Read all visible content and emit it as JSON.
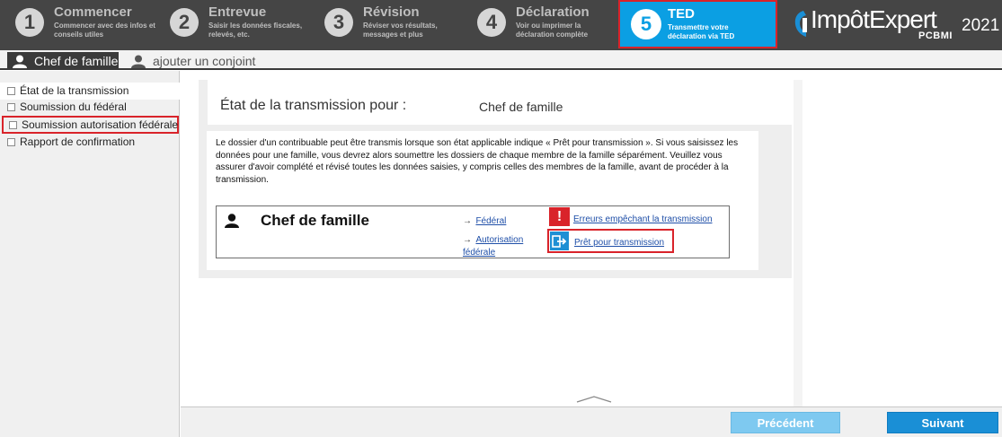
{
  "steps": [
    {
      "num": "1",
      "title": "Commencer",
      "desc": "Commencer avec des infos et conseils utiles"
    },
    {
      "num": "2",
      "title": "Entrevue",
      "desc": "Saisir les données fiscales, relevés, etc."
    },
    {
      "num": "3",
      "title": "Révision",
      "desc": "Réviser vos résultats, messages et plus"
    },
    {
      "num": "4",
      "title": "Déclaration",
      "desc": "Voir ou imprimer la déclaration complète"
    },
    {
      "num": "5",
      "title": "TED",
      "desc": "Transmettre votre déclaration via TED"
    }
  ],
  "logo": {
    "brand": "ImpôtExpert",
    "sub": "PCBMI",
    "year": "2021"
  },
  "tabs": {
    "active": "Chef de famille",
    "add": "ajouter un conjoint"
  },
  "sidebar": {
    "items": [
      {
        "label": "État de la transmission"
      },
      {
        "label": "Soumission du fédéral"
      },
      {
        "label": "Soumission autorisation fédérale"
      },
      {
        "label": "Rapport de confirmation"
      }
    ]
  },
  "main": {
    "heading": "État de la transmission pour :",
    "member": "Chef de famille",
    "info": "Le dossier d'un contribuable peut être transmis lorsque son état applicable indique « Prêt pour transmission ». Si vous saisissez les données pour une famille, vous devrez alors soumettre les dossiers de chaque membre de la famille séparément. Veuillez vous assurer d'avoir complété et révisé toutes les données saisies, y compris celles des membres de la famille, avant de procéder à la transmission.",
    "member_card": {
      "name": "Chef de famille",
      "arrow": "→",
      "link_federal": "Fédéral",
      "link_auth_1": "Autorisation",
      "link_auth_2": "fédérale",
      "errors_link": "Erreurs empêchant la transmission",
      "ready_link": "Prêt pour transmission"
    }
  },
  "footer": {
    "prev": "Précédent",
    "next": "Suivant"
  },
  "colors": {
    "accent": "#0b9fe3",
    "highlight": "#d9232a",
    "topbar": "#454545"
  }
}
